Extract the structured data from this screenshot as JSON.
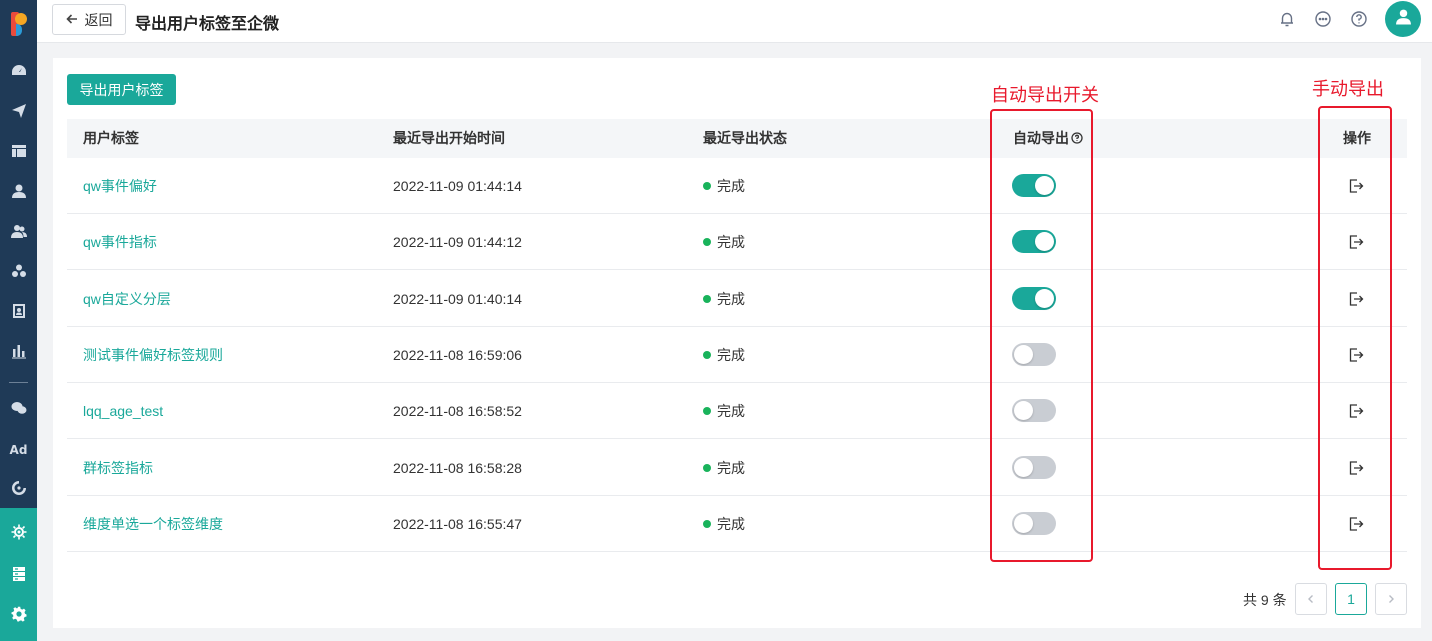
{
  "header": {
    "back_label": "返回",
    "title": "导出用户标签至企微"
  },
  "sidebar": {
    "items": [
      {
        "icon": "dashboard-icon"
      },
      {
        "icon": "send-icon"
      },
      {
        "icon": "layout-icon"
      },
      {
        "icon": "user-icon"
      },
      {
        "icon": "users-icon"
      },
      {
        "icon": "cluster-icon"
      },
      {
        "icon": "portrait-icon"
      },
      {
        "icon": "bar-chart-icon"
      },
      {
        "icon": "wechat-icon"
      },
      {
        "icon": "ad-icon",
        "label": "Ad"
      },
      {
        "icon": "ring-icon"
      },
      {
        "icon": "tag-export-icon"
      },
      {
        "icon": "server-icon"
      },
      {
        "icon": "settings-icon"
      }
    ]
  },
  "main": {
    "export_button": "导出用户标签",
    "columns": [
      "用户标签",
      "最近导出开始时间",
      "最近导出状态",
      "自动导出",
      "操作"
    ],
    "rows": [
      {
        "tag": "qw事件偏好",
        "time": "2022-11-09 01:44:14",
        "status": "完成",
        "auto_export": true
      },
      {
        "tag": "qw事件指标",
        "time": "2022-11-09 01:44:12",
        "status": "完成",
        "auto_export": true
      },
      {
        "tag": "qw自定义分层",
        "time": "2022-11-09 01:40:14",
        "status": "完成",
        "auto_export": true
      },
      {
        "tag": "测试事件偏好标签规则",
        "time": "2022-11-08 16:59:06",
        "status": "完成",
        "auto_export": false
      },
      {
        "tag": "lqq_age_test",
        "time": "2022-11-08 16:58:52",
        "status": "完成",
        "auto_export": false
      },
      {
        "tag": "群标签指标",
        "time": "2022-11-08 16:58:28",
        "status": "完成",
        "auto_export": false
      },
      {
        "tag": "维度单选一个标签维度",
        "time": "2022-11-08 16:55:47",
        "status": "完成",
        "auto_export": false
      }
    ]
  },
  "annotations": {
    "auto_export_label": "自动导出开关",
    "manual_export_label": "手动导出"
  },
  "pagination": {
    "total": "共 9 条",
    "current_page": "1"
  },
  "colors": {
    "accent": "#1aa89a",
    "sidebar": "#1f3a57",
    "status_done": "#19b35b",
    "annotation": "#e8192c"
  }
}
